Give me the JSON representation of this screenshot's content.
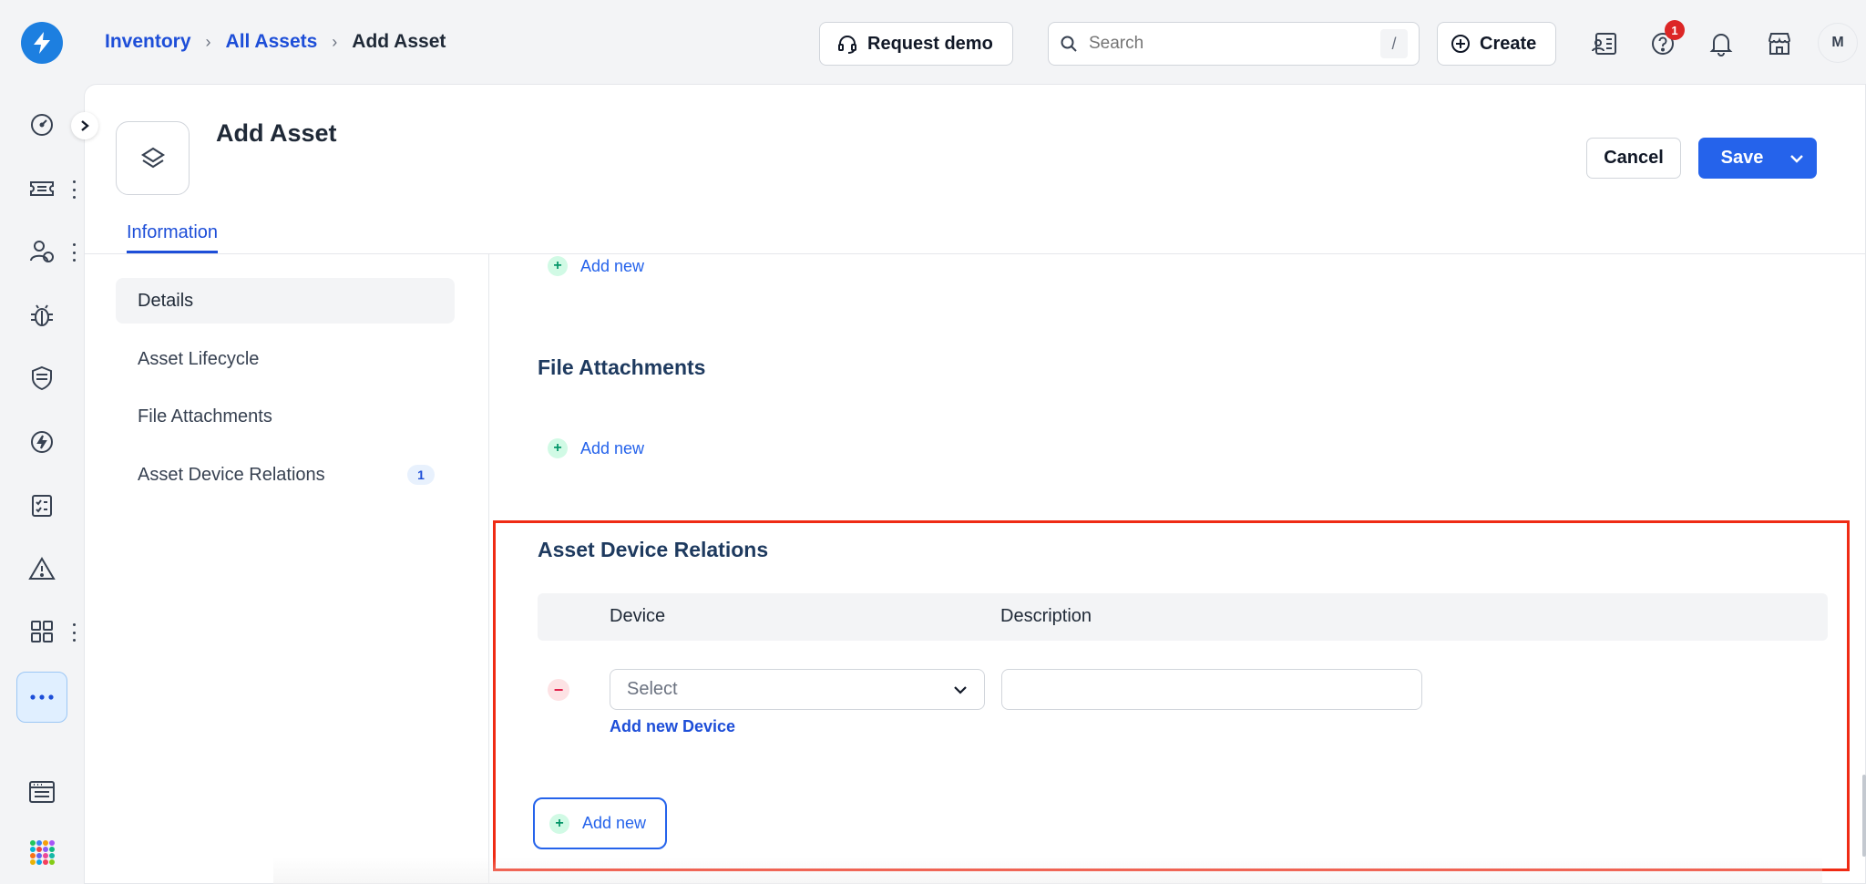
{
  "breadcrumb": {
    "items": [
      {
        "label": "Inventory"
      },
      {
        "label": "All Assets"
      },
      {
        "label": "Add Asset"
      }
    ]
  },
  "topbar": {
    "request_demo": "Request demo",
    "search_placeholder": "Search",
    "search_shortcut": "/",
    "create": "Create",
    "help_badge": "1",
    "avatar_initial": "M"
  },
  "page": {
    "title": "Add Asset",
    "cancel_label": "Cancel",
    "save_label": "Save",
    "tab_label": "Information"
  },
  "sidenav": {
    "items": [
      {
        "label": "Details"
      },
      {
        "label": "Asset Lifecycle"
      },
      {
        "label": "File Attachments"
      },
      {
        "label": "Asset Device Relations",
        "count": "1"
      }
    ]
  },
  "content": {
    "add_new_label": "Add new",
    "file_attachments_title": "File Attachments",
    "relations_title": "Asset Device Relations",
    "col_device": "Device",
    "col_description": "Description",
    "select_placeholder": "Select",
    "add_new_device": "Add new Device"
  },
  "colors": {
    "accent": "#2563eb",
    "highlight": "#ef2b14",
    "logo": "#1d7fe0"
  }
}
